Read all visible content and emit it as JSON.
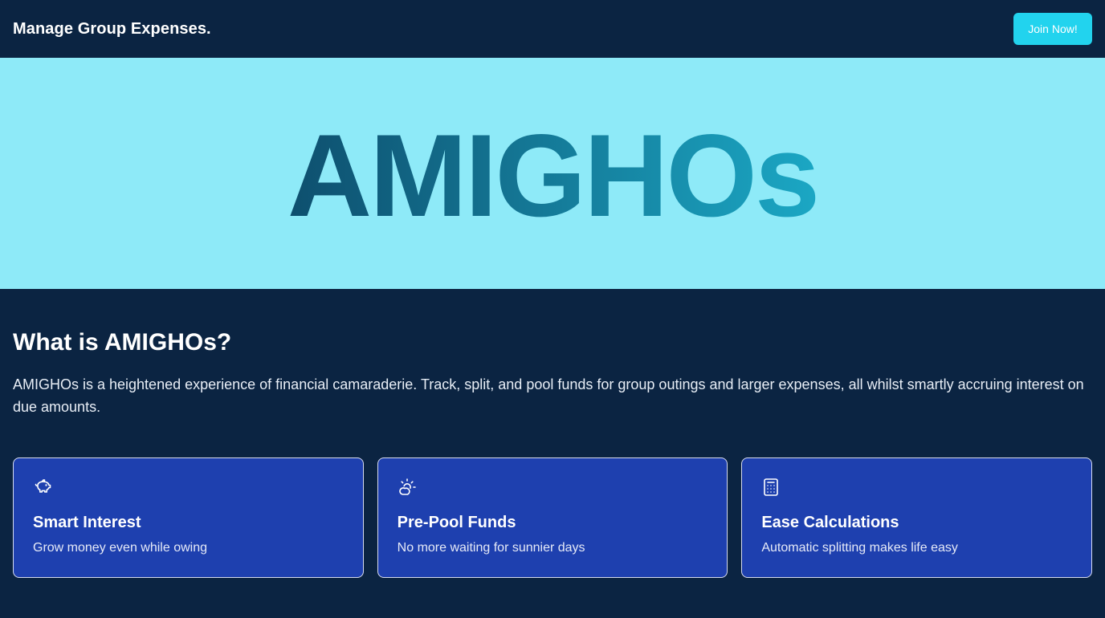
{
  "header": {
    "title": "Manage Group Expenses.",
    "join_label": "Join Now!"
  },
  "hero": {
    "brand": "AMIGHOs",
    "gradient_start": "#0e4f6e",
    "gradient_end": "#1ba7c4",
    "background": "#8eeaf8"
  },
  "about": {
    "heading": "What is AMIGHOs?",
    "text": "AMIGHOs is a heightened experience of financial camaraderie. Track, split, and pool funds for group outings and larger expenses, all whilst smartly accruing interest on due amounts."
  },
  "features": [
    {
      "icon": "piggy-bank-icon",
      "title": "Smart Interest",
      "description": "Grow money even while owing"
    },
    {
      "icon": "sun-cloud-icon",
      "title": "Pre-Pool Funds",
      "description": "No more waiting for sunnier days"
    },
    {
      "icon": "calculator-icon",
      "title": "Ease Calculations",
      "description": "Automatic splitting makes life easy"
    }
  ],
  "colors": {
    "page_bg": "#0b2442",
    "accent": "#22d3ee",
    "card_bg": "#1e40af"
  }
}
